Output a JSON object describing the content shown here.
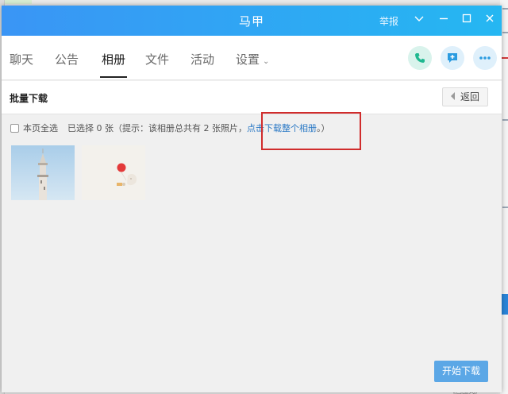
{
  "window": {
    "title": "马甲",
    "report_label": "举报"
  },
  "tabs": [
    {
      "label": "聊天",
      "active": false
    },
    {
      "label": "公告",
      "active": false
    },
    {
      "label": "相册",
      "active": true
    },
    {
      "label": "文件",
      "active": false
    },
    {
      "label": "活动",
      "active": false
    },
    {
      "label": "设置",
      "active": false
    }
  ],
  "toolbar": {
    "heading": "批量下载",
    "back_label": "返回"
  },
  "selection": {
    "select_all_label": "本页全选",
    "selected_text": "已选择 0 张",
    "hint_text": "（提示：该相册总共有 2 张照片，",
    "download_all_link": "点击下载整个相册",
    "hint_end": "。）"
  },
  "photos": [
    {
      "icon": "minaret-photo"
    },
    {
      "icon": "red-balloon-photo"
    }
  ],
  "actions": {
    "start_download_label": "开始下载"
  },
  "background": {
    "bottom_text": "《画图式》"
  },
  "colors": {
    "title_gradient_start": "#3a95f5",
    "title_gradient_end": "#25b7f2",
    "link": "#2b79c5",
    "highlight": "#d02c2c",
    "primary_button": "#5ba7e6"
  }
}
